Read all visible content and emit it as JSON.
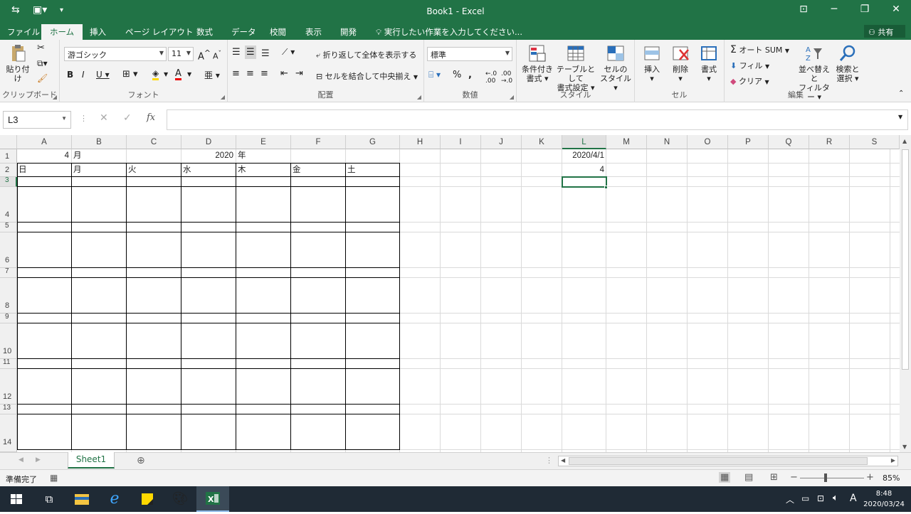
{
  "window": {
    "title": "Book1 - Excel",
    "share": "共有"
  },
  "tabs": [
    "ファイル",
    "ホーム",
    "挿入",
    "ページ レイアウト",
    "数式",
    "データ",
    "校閲",
    "表示",
    "開発"
  ],
  "tell_me": "実行したい作業を入力してください...",
  "ribbon": {
    "clipboard": {
      "label": "クリップボード",
      "paste": "貼り付け"
    },
    "font": {
      "label": "フォント",
      "name": "游ゴシック",
      "size": "11"
    },
    "alignment": {
      "label": "配置",
      "wrap": "折り返して全体を表示する",
      "merge": "セルを結合して中央揃え"
    },
    "number": {
      "label": "数値",
      "format": "標準"
    },
    "styles": {
      "label": "スタイル",
      "cond1": "条件付き",
      "cond2": "書式 ▾",
      "table1": "テーブルとして",
      "table2": "書式設定 ▾",
      "cell1": "セルの",
      "cell2": "スタイル ▾"
    },
    "cells": {
      "label": "セル",
      "insert": "挿入",
      "delete": "削除",
      "format": "書式"
    },
    "editing": {
      "label": "編集",
      "autosum": "オート SUM",
      "fill": "フィル",
      "clear": "クリア",
      "sort1": "並べ替えと",
      "sort2": "フィルター",
      "find1": "検索と",
      "find2": "選択"
    }
  },
  "formula_bar": {
    "name_box": "L3",
    "value": ""
  },
  "columns": [
    "A",
    "B",
    "C",
    "D",
    "E",
    "F",
    "G",
    "H",
    "I",
    "J",
    "K",
    "L",
    "M",
    "N",
    "O",
    "P",
    "Q",
    "R",
    "S"
  ],
  "rows": [
    "1",
    "2",
    "3",
    "4",
    "5",
    "6",
    "7",
    "8",
    "9",
    "10",
    "11",
    "12",
    "13",
    "14"
  ],
  "cells": {
    "A1": "4",
    "B1": "月",
    "D1": "2020",
    "E1": "年",
    "A2": "日",
    "B2": "月",
    "C2": "火",
    "D2": "水",
    "E2": "木",
    "F2": "金",
    "G2": "土",
    "L1": "2020/4/1",
    "L2": "4"
  },
  "sheet_tab": "Sheet1",
  "status": {
    "ready": "準備完了",
    "zoom": "85%"
  },
  "taskbar": {
    "time": "8:48",
    "date": "2020/03/24",
    "ime": "A"
  }
}
